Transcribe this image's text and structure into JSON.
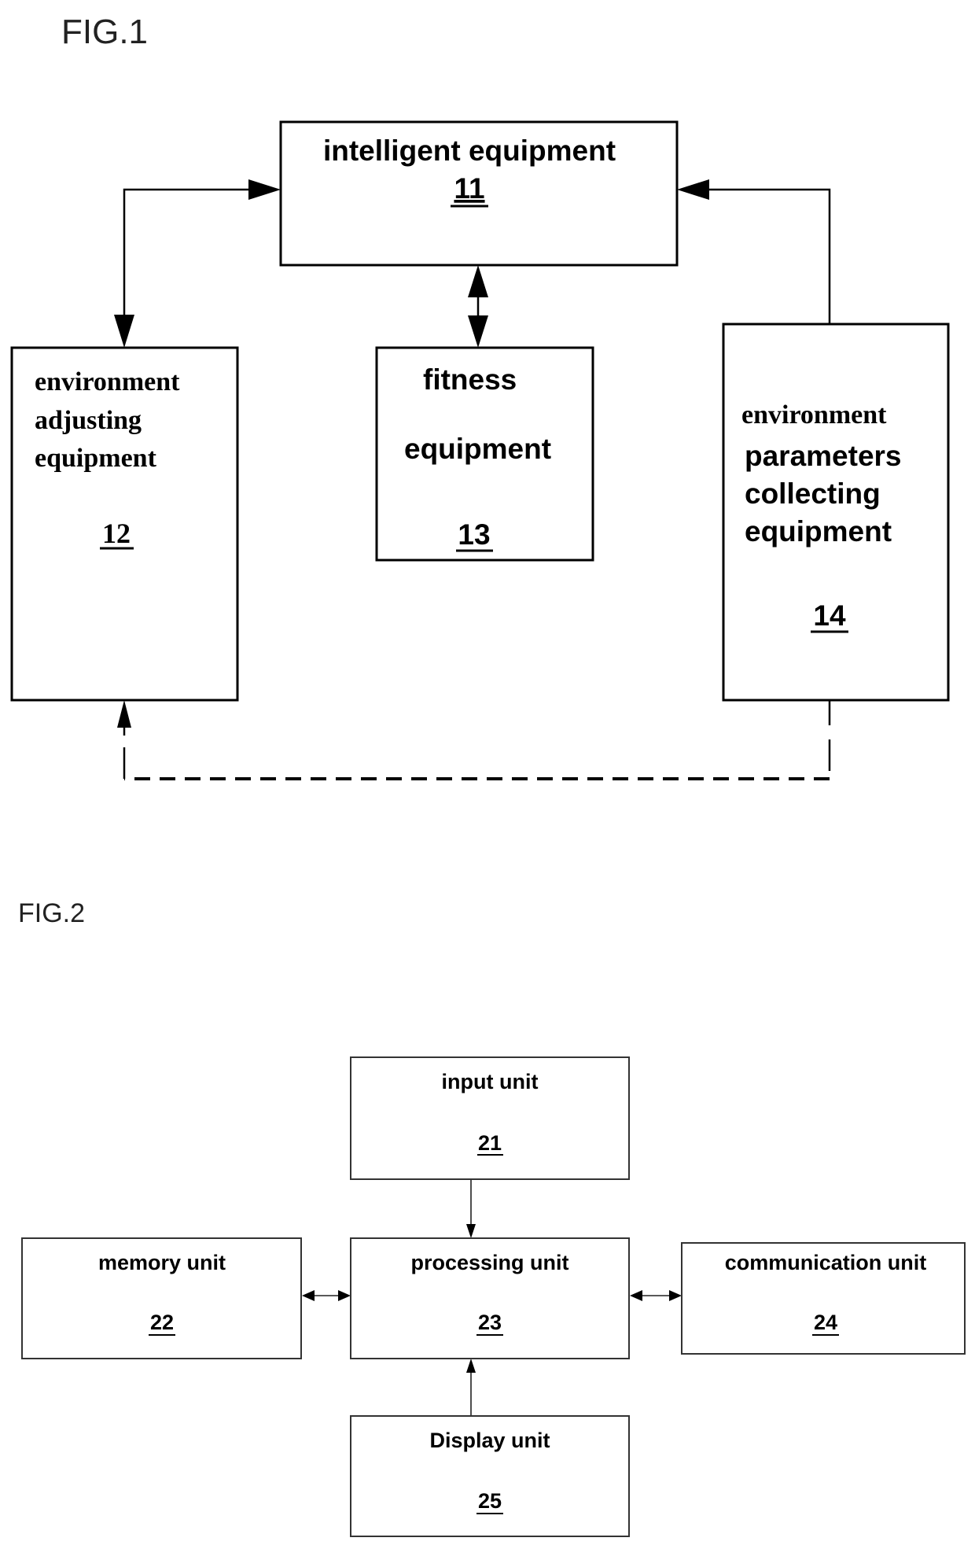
{
  "fig1": {
    "title": "FIG.1",
    "blocks": {
      "b11": {
        "lines": [
          "intelligent equipment"
        ],
        "ref": "11"
      },
      "b12": {
        "lines": [
          "environment",
          "adjusting",
          "equipment"
        ],
        "ref": "12"
      },
      "b13": {
        "lines": [
          "fitness",
          "equipment"
        ],
        "ref": "13"
      },
      "b14": {
        "lines": [
          "environment",
          "parameters",
          "collecting",
          "equipment"
        ],
        "ref": "14"
      }
    },
    "connections": [
      {
        "from": "11",
        "to": "12",
        "type": "bidirectional",
        "style": "solid"
      },
      {
        "from": "11",
        "to": "13",
        "type": "bidirectional",
        "style": "solid"
      },
      {
        "from": "14",
        "to": "11",
        "type": "directed",
        "style": "solid"
      },
      {
        "from": "14",
        "to": "12",
        "type": "directed",
        "style": "dashed"
      }
    ]
  },
  "fig2": {
    "title": "FIG.2",
    "blocks": {
      "b21": {
        "label": "input unit",
        "ref": "21"
      },
      "b22": {
        "label": "memory unit",
        "ref": "22"
      },
      "b23": {
        "label": "processing unit",
        "ref": "23"
      },
      "b24": {
        "label": "communication unit",
        "ref": "24"
      },
      "b25": {
        "label": "Display unit",
        "ref": "25"
      }
    },
    "connections": [
      {
        "from": "21",
        "to": "23",
        "type": "directed"
      },
      {
        "from": "25",
        "to": "23",
        "type": "directed"
      },
      {
        "from": "22",
        "to": "23",
        "type": "bidirectional"
      },
      {
        "from": "23",
        "to": "24",
        "type": "bidirectional"
      }
    ]
  }
}
